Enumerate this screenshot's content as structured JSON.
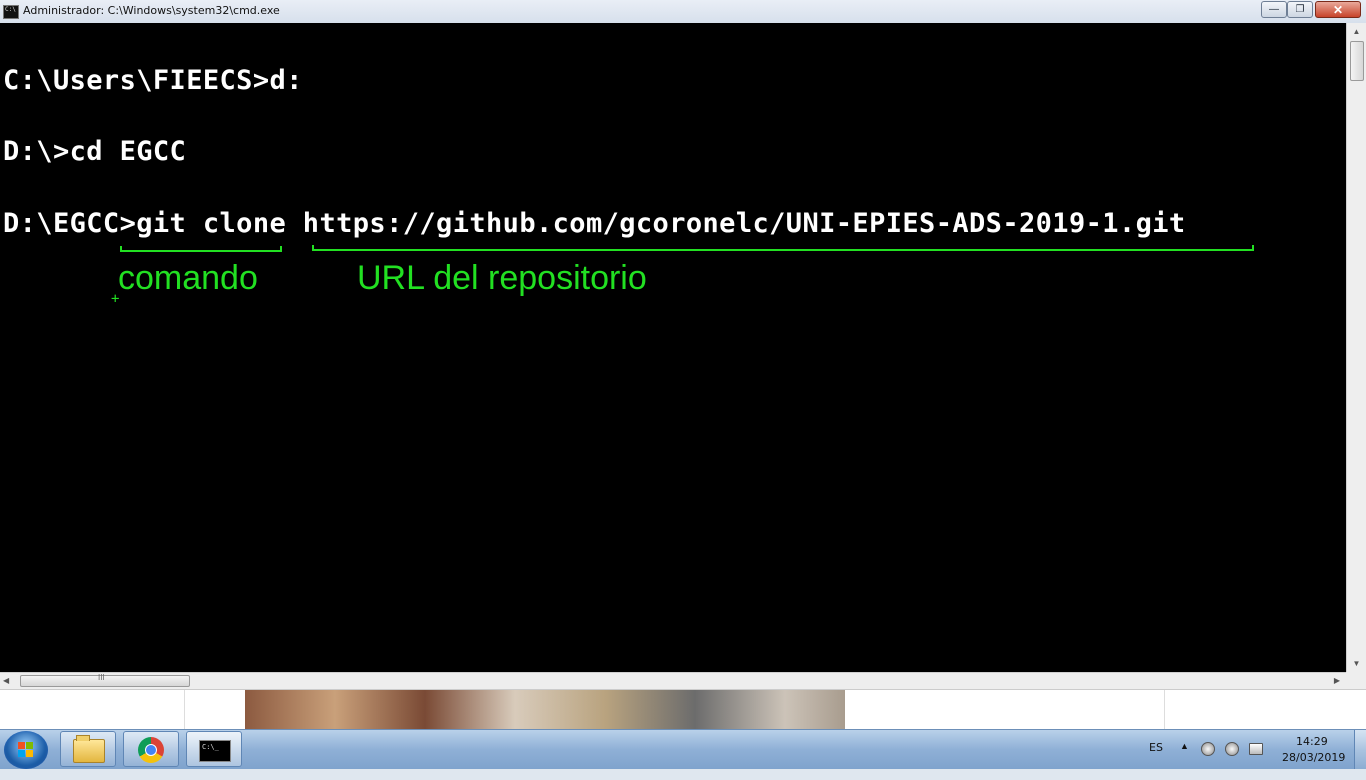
{
  "window": {
    "title": "Administrador: C:\\Windows\\system32\\cmd.exe",
    "min_glyph": "—",
    "max_glyph": "❐",
    "close_glyph": "✕"
  },
  "console": {
    "lines": [
      "C:\\Users\\FIEECS>d:",
      "D:\\>cd EGCC",
      "D:\\EGCC>git clone https://github.com/gcoronelc/UNI-EPIES-ADS-2019-1.git"
    ],
    "annotations": {
      "command_label": "comando",
      "url_label": "URL del repositorio",
      "color": "#22e022"
    }
  },
  "scrollbars": {
    "up": "▲",
    "down": "▼",
    "left": "◀",
    "right": "▶",
    "grip": "III"
  },
  "taskbar": {
    "items": [
      "windows-explorer",
      "google-chrome",
      "command-prompt"
    ],
    "cmd_icon_text": "C:\\_",
    "language": "ES",
    "tray_arrow": "▲",
    "time": "14:29",
    "date": "28/03/2019"
  }
}
